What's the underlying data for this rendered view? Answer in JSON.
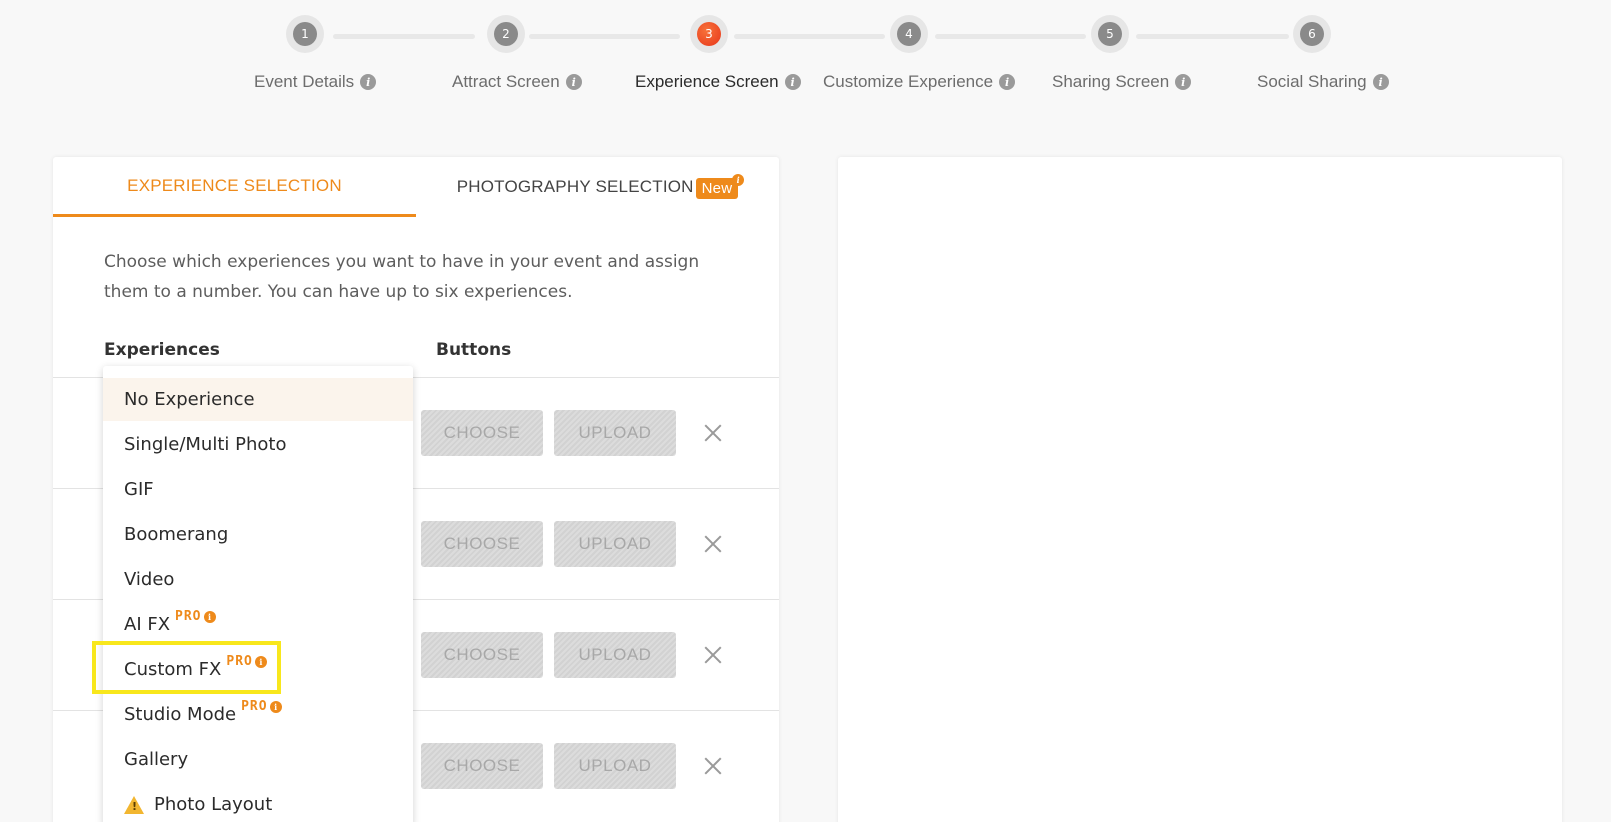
{
  "stepper": {
    "steps": [
      {
        "number": "1",
        "label": "Event Details",
        "active": false
      },
      {
        "number": "2",
        "label": "Attract Screen",
        "active": false
      },
      {
        "number": "3",
        "label": "Experience Screen",
        "active": true
      },
      {
        "number": "4",
        "label": "Customize Experience",
        "active": false
      },
      {
        "number": "5",
        "label": "Sharing Screen",
        "active": false
      },
      {
        "number": "6",
        "label": "Social Sharing",
        "active": false
      }
    ],
    "info_glyph": "i",
    "active_color": "#e8361a"
  },
  "tabs": {
    "experience": "EXPERIENCE SELECTION",
    "photography": "PHOTOGRAPHY SELECTION",
    "new_badge": "New",
    "accent_color": "#ee8a1b"
  },
  "description": "Choose which experiences you want to have in your event and assign them to a number. You can have up to six experiences.",
  "columns": {
    "experiences": "Experiences",
    "buttons": "Buttons"
  },
  "rows": [
    {
      "choose": "CHOOSE",
      "upload": "UPLOAD"
    },
    {
      "choose": "CHOOSE",
      "upload": "UPLOAD"
    },
    {
      "choose": "CHOOSE",
      "upload": "UPLOAD"
    },
    {
      "choose": "CHOOSE",
      "upload": "UPLOAD"
    }
  ],
  "dropdown": {
    "items": [
      {
        "label": "No Experience",
        "pro": false
      },
      {
        "label": "Single/Multi Photo",
        "pro": false
      },
      {
        "label": "GIF",
        "pro": false
      },
      {
        "label": "Boomerang",
        "pro": false
      },
      {
        "label": "Video",
        "pro": false
      },
      {
        "label": "AI FX",
        "pro": true
      },
      {
        "label": "Custom FX",
        "pro": true
      },
      {
        "label": "Studio Mode",
        "pro": true
      },
      {
        "label": "Gallery",
        "pro": false
      },
      {
        "label": "Photo Layout",
        "pro": false,
        "warning": true
      }
    ],
    "pro_label": "PRO",
    "highlighted_item": "Custom FX"
  }
}
